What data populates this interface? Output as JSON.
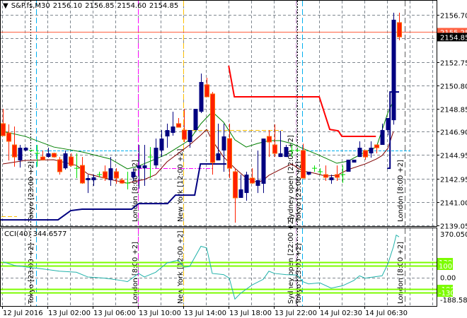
{
  "header": {
    "arrow_icon": "triangle-down-icon",
    "symbol": "S&P.fs,M30",
    "open": "2156.10",
    "high": "2156.85",
    "low": "2154.60",
    "close": "2154.85"
  },
  "cci_header": {
    "name": "CCI(40)",
    "value": "344.6577"
  },
  "colors": {
    "bull": "#000080",
    "bear": "#ff2000",
    "doji": "#00e000",
    "ma_fast": "#008000",
    "ma_slow": "#800000",
    "stop_high": "#ff0000",
    "stop_low": "#000080",
    "cci": "#20b2aa",
    "level": "#7cfc00",
    "price_line": "#ff6040"
  },
  "price_axis": {
    "ticks": [
      "2156.70",
      "2152.75",
      "2150.80",
      "2148.85",
      "2146.90",
      "2144.95",
      "2142.95",
      "2141.00",
      "2139.05"
    ],
    "ask_label": "2155.25",
    "bid_label": "2154.85"
  },
  "cci_axis": {
    "max": "370.0503",
    "min": "-188.5871",
    "zero": "0.00",
    "levels": [
      "130",
      "100",
      "-100",
      "-130"
    ]
  },
  "time_axis": [
    "12 Jul 2016",
    "13 Jul 02:00",
    "13 Jul 06:00",
    "13 Jul 10:00",
    "13 Jul 14:00",
    "13 Jul 18:00",
    "13 Jul 22:00",
    "14 Jul 02:30",
    "14 Jul 06:30"
  ],
  "sessions": [
    "Tokyo  [23:00 +2]",
    "London  [8:00 +2]",
    "New York  [12:00 +2]",
    "Sydney open  [22:00 +2]",
    "Tokyo  [23:00 +2]",
    "London  [8:00 +2]"
  ],
  "chart_data": {
    "type": "candlestick",
    "timeframe": "M30",
    "ylim": [
      2139.05,
      2156.7
    ],
    "ohlc": [
      [
        2147.58,
        2148.82,
        2146.57,
        2146.57
      ],
      [
        2146.81,
        2147.52,
        2144.5,
        2146.1
      ],
      [
        2145.8,
        2147.34,
        2143.97,
        2144.79
      ],
      [
        2144.5,
        2145.8,
        2143.9,
        2145.56
      ],
      [
        2145.33,
        2145.62,
        2145.27,
        2145.56
      ],
      [
        2145.33,
        2145.38,
        2145.27,
        2145.33
      ],
      [
        2145.09,
        2145.8,
        2143.97,
        2145.1
      ],
      [
        2144.79,
        2145.33,
        2144.5,
        2144.56
      ],
      [
        2144.79,
        2145.56,
        2144.73,
        2145.09
      ],
      [
        2145.09,
        2145.15,
        2144.73,
        2144.79
      ],
      [
        2144.56,
        2144.79,
        2143.31,
        2143.55
      ],
      [
        2143.84,
        2145.33,
        2143.73,
        2145.09
      ],
      [
        2144.79,
        2145.09,
        2143.97,
        2144.08
      ],
      [
        2143.84,
        2145.09,
        2143.02,
        2143.84
      ],
      [
        2144.08,
        2144.79,
        2142.54,
        2142.6
      ],
      [
        2142.84,
        2143.31,
        2141.77,
        2143.02
      ],
      [
        2142.84,
        2143.31,
        2142.37,
        2143.08
      ],
      [
        2143.31,
        2143.55,
        2143.08,
        2143.31
      ],
      [
        2143.55,
        2144.08,
        2142.78,
        2143.02
      ],
      [
        2142.84,
        2144.79,
        2142.37,
        2143.84
      ],
      [
        2143.55,
        2143.84,
        2142.54,
        2143.02
      ],
      [
        2142.84,
        2143.02,
        2142.54,
        2142.6
      ],
      [
        2142.6,
        2143.55,
        2142.07,
        2142.62
      ],
      [
        2143.08,
        2143.84,
        2142.78,
        2143.55
      ],
      [
        2143.84,
        2145.8,
        2142.13,
        2144.08
      ],
      [
        2143.84,
        2145.8,
        2142.37,
        2144.08
      ],
      [
        2144.79,
        2145.62,
        2143.02,
        2144.8
      ],
      [
        2144.08,
        2146.33,
        2143.84,
        2145.56
      ],
      [
        2145.33,
        2147.04,
        2144.79,
        2146.33
      ],
      [
        2146.51,
        2147.58,
        2145.56,
        2147.04
      ],
      [
        2146.81,
        2148.58,
        2146.57,
        2147.34
      ],
      [
        2147.58,
        2148.05,
        2147.28,
        2147.28
      ],
      [
        2147.04,
        2148.82,
        2146.04,
        2146.27
      ],
      [
        2146.04,
        2147.04,
        2145.56,
        2147.04
      ],
      [
        2147.04,
        2148.82,
        2147.04,
        2148.82
      ],
      [
        2148.58,
        2151.78,
        2148.47,
        2151.07
      ],
      [
        2150.84,
        2151.43,
        2149.83,
        2149.83
      ],
      [
        2150.07,
        2150.24,
        2143.31,
        2144.32
      ],
      [
        2144.5,
        2147.58,
        2144.5,
        2145.09
      ],
      [
        2145.33,
        2147.58,
        2143.55,
        2146.51
      ],
      [
        2146.33,
        2147.58,
        2143.02,
        2143.84
      ],
      [
        2143.55,
        2143.84,
        2139.28,
        2141.36
      ],
      [
        2141.36,
        2143.31,
        2141.36,
        2142.07
      ],
      [
        2141.77,
        2143.55,
        2141.12,
        2143.31
      ],
      [
        2143.02,
        2143.84,
        2142.54,
        2142.6
      ],
      [
        2142.37,
        2145.33,
        2141.77,
        2142.84
      ],
      [
        2142.54,
        2146.33,
        2141.77,
        2146.33
      ],
      [
        2146.51,
        2147.04,
        2144.79,
        2146.04
      ],
      [
        2145.8,
        2147.52,
        2144.79,
        2145.09
      ],
      [
        2144.79,
        2146.98,
        2144.79,
        2145.09
      ],
      [
        2144.79,
        2145.8,
        2144.79,
        2145.62
      ],
      [
        2145.33,
        2145.8,
        2144.79,
        2145.33
      ],
      [
        2145.33,
        2145.5,
        2145.2,
        2145.33
      ],
      [
        2145.33,
        2145.9,
        2143.02,
        2143.02
      ],
      [
        2143.31,
        2143.55,
        2143.25,
        2143.55
      ],
      [
        2143.84,
        2144.08,
        2143.55,
        2143.84
      ],
      [
        2143.55,
        2143.84,
        2143.31,
        2143.55
      ],
      [
        2143.31,
        2144.08,
        2142.78,
        2143.08
      ],
      [
        2142.84,
        2143.31,
        2142.54,
        2143.08
      ],
      [
        2143.31,
        2144.08,
        2142.78,
        2143.08
      ],
      [
        2143.31,
        2144.08,
        2142.62,
        2143.32
      ],
      [
        2143.55,
        2144.56,
        2143.55,
        2144.56
      ],
      [
        2144.32,
        2144.56,
        2144.32,
        2144.56
      ],
      [
        2144.79,
        2146.1,
        2144.79,
        2145.56
      ],
      [
        2145.33,
        2145.33,
        2144.56,
        2144.79
      ],
      [
        2145.09,
        2146.1,
        2144.73,
        2145.56
      ],
      [
        2145.8,
        2145.8,
        2145.09,
        2145.56
      ],
      [
        2145.8,
        2147.58,
        2145.8,
        2147.04
      ],
      [
        2147.04,
        2148.05,
        2146.6,
        2148.05
      ],
      [
        2147.87,
        2156.88,
        2147.5,
        2156.29
      ],
      [
        2156.05,
        2156.88,
        2154.57,
        2154.85
      ]
    ],
    "ma_fast": [
      [
        0,
        2146.93
      ],
      [
        4,
        2146.51
      ],
      [
        9,
        2145.62
      ],
      [
        14,
        2145.21
      ],
      [
        19,
        2144.62
      ],
      [
        22,
        2143.79
      ],
      [
        24,
        2144.03
      ],
      [
        27,
        2144.62
      ],
      [
        29,
        2145.03
      ],
      [
        31,
        2145.62
      ],
      [
        33,
        2146.22
      ],
      [
        35,
        2147.58
      ],
      [
        37,
        2148.58
      ],
      [
        39,
        2147.7
      ],
      [
        41,
        2146.22
      ],
      [
        43,
        2145.62
      ],
      [
        45,
        2145.92
      ],
      [
        47,
        2146.16
      ],
      [
        49,
        2146.16
      ],
      [
        51,
        2145.92
      ],
      [
        53,
        2145.5
      ],
      [
        56,
        2144.91
      ],
      [
        59,
        2144.26
      ],
      [
        61,
        2144.44
      ],
      [
        64,
        2145.21
      ],
      [
        66,
        2145.62
      ],
      [
        68,
        2148.47
      ],
      [
        69,
        2149.5
      ]
    ],
    "ma_slow": [
      [
        0,
        2144.2
      ],
      [
        4,
        2144.5
      ],
      [
        9,
        2144.56
      ],
      [
        13,
        2144.08
      ],
      [
        15,
        2143.37
      ],
      [
        19,
        2142.9
      ],
      [
        22,
        2142.6
      ],
      [
        25,
        2142.9
      ],
      [
        27,
        2143.31
      ],
      [
        29,
        2144.38
      ],
      [
        31,
        2145.09
      ],
      [
        33,
        2145.8
      ],
      [
        35,
        2146.63
      ],
      [
        36,
        2147.1
      ],
      [
        37,
        2146.16
      ],
      [
        39,
        2144.79
      ],
      [
        41,
        2143.84
      ],
      [
        43,
        2143.02
      ],
      [
        45,
        2142.66
      ],
      [
        46,
        2142.84
      ],
      [
        47,
        2143.25
      ],
      [
        49,
        2143.73
      ],
      [
        51,
        2144.2
      ],
      [
        53,
        2143.61
      ],
      [
        55,
        2143.43
      ],
      [
        57,
        2143.19
      ],
      [
        59,
        2143.25
      ],
      [
        61,
        2143.73
      ],
      [
        64,
        2144.2
      ],
      [
        66,
        2144.62
      ],
      [
        67,
        2144.91
      ],
      [
        68,
        2145.5
      ],
      [
        69,
        2146.92
      ]
    ],
    "stop_high": [
      [
        39.9,
        2152.43
      ],
      [
        40.9,
        2149.83
      ],
      [
        55.9,
        2149.83
      ],
      [
        57.75,
        2147.1
      ],
      [
        59.25,
        2146.98
      ],
      [
        59.9,
        2146.51
      ],
      [
        65.9,
        2146.51
      ]
    ],
    "stop_low": [
      [
        -0.5,
        2139.52
      ],
      [
        9.75,
        2139.52
      ],
      [
        12,
        2140.29
      ],
      [
        14,
        2140.41
      ],
      [
        22.75,
        2140.41
      ],
      [
        24,
        2140.88
      ],
      [
        29.1,
        2140.88
      ],
      [
        30.5,
        2141.59
      ],
      [
        33.9,
        2141.59
      ],
      [
        34.9,
        2144.2
      ],
      [
        39.5,
        2144.2
      ]
    ],
    "stop_low_tail": [
      [
        67.9,
        2143.84
      ],
      [
        68.4,
        2143.84
      ],
      [
        68.4,
        2150.24
      ],
      [
        70,
        2150.24
      ]
    ],
    "cci": {
      "ylim": [
        -188.5871,
        370.0503
      ],
      "levels": [
        130,
        100,
        0,
        -100,
        -130
      ],
      "points": [
        [
          0,
          133
        ],
        [
          2,
          103
        ],
        [
          5,
          83
        ],
        [
          7,
          73
        ],
        [
          10,
          53
        ],
        [
          13,
          44
        ],
        [
          15,
          4
        ],
        [
          18,
          -6
        ],
        [
          21,
          -26
        ],
        [
          22,
          -36
        ],
        [
          24,
          34
        ],
        [
          25,
          4
        ],
        [
          27,
          44
        ],
        [
          29,
          123
        ],
        [
          31,
          147
        ],
        [
          32,
          87
        ],
        [
          33,
          93
        ],
        [
          35,
          265
        ],
        [
          36,
          251
        ],
        [
          37,
          34
        ],
        [
          39,
          24
        ],
        [
          40,
          -6
        ],
        [
          41,
          -184
        ],
        [
          42,
          -135
        ],
        [
          44,
          -65
        ],
        [
          46,
          -16
        ],
        [
          47,
          53
        ],
        [
          48,
          34
        ],
        [
          50,
          24
        ],
        [
          52,
          20
        ],
        [
          53,
          -36
        ],
        [
          54,
          -55
        ],
        [
          56,
          -46
        ],
        [
          58,
          -91
        ],
        [
          60,
          -71
        ],
        [
          62,
          -26
        ],
        [
          63,
          14
        ],
        [
          64,
          -6
        ],
        [
          67,
          14
        ],
        [
          68,
          113
        ],
        [
          69,
          261
        ],
        [
          69.5,
          360
        ],
        [
          70,
          344.66
        ]
      ]
    }
  }
}
